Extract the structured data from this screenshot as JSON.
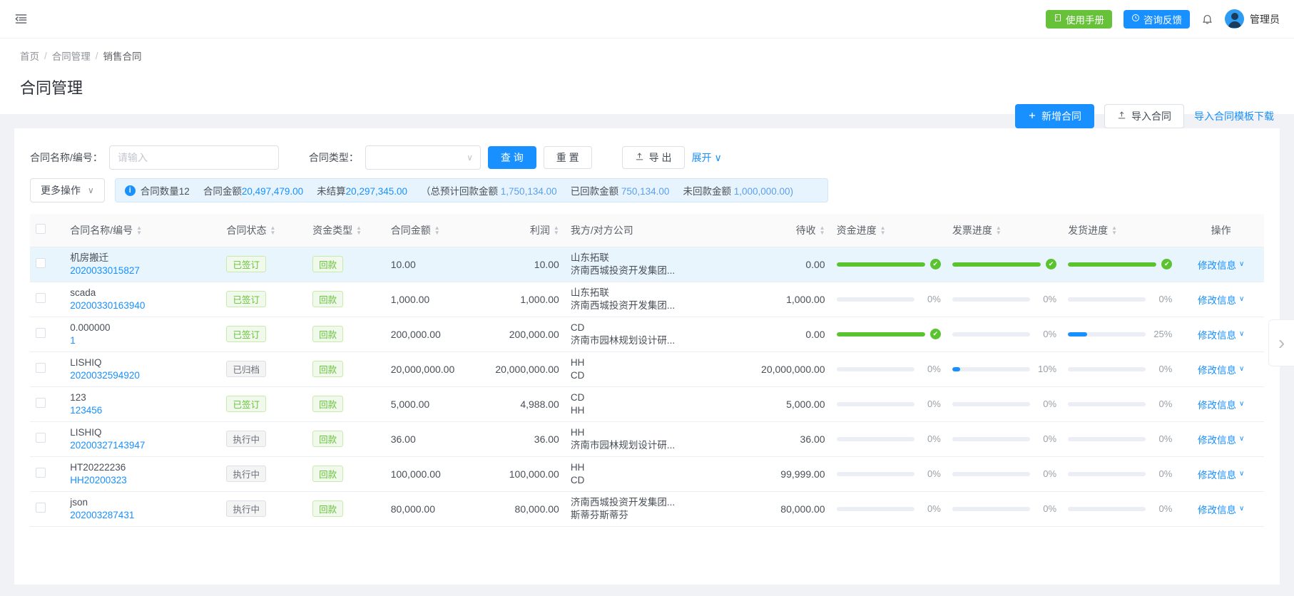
{
  "topbar": {
    "collapse_icon": "menu-fold-icon",
    "manual_button": "使用手册",
    "feedback_button": "咨询反馈",
    "bell_icon": "bell-icon",
    "user_name": "管理员"
  },
  "breadcrumb": {
    "items": [
      "首页",
      "合同管理",
      "销售合同"
    ],
    "separator": "/"
  },
  "page_title": "合同管理",
  "head_actions": {
    "add": "新增合同",
    "add_icon": "plus-icon",
    "import": "导入合同",
    "import_icon": "upload-icon",
    "template_link": "导入合同模板下载"
  },
  "filters": {
    "name_label": "合同名称/编号：",
    "name_value": "",
    "name_placeholder": "请输入",
    "type_label": "合同类型：",
    "type_value": "",
    "search": "查 询",
    "reset": "重 置",
    "export": "导 出",
    "export_icon": "upload-icon",
    "expand": "展开",
    "expand_caret": "∨"
  },
  "toolbar": {
    "more": "更多操作",
    "more_caret": "∨",
    "banner": {
      "info_icon": "info-icon",
      "count_label": "合同数量",
      "count_value": "12",
      "amount_label": "合同金额",
      "amount_value": "20,497,479.00",
      "unsettled_label": "未结算",
      "unsettled_value": "20,297,345.00",
      "paren_open": "（总预计回款金额",
      "expected_value": "1,750,134.00",
      "received_label": "已回款金额",
      "received_value": "750,134.00",
      "unreceived_label": "未回款金额",
      "unreceived_value": "1,000,000.00)"
    }
  },
  "table": {
    "columns": [
      {
        "label": "",
        "name": "select-all",
        "sortable": false
      },
      {
        "label": "合同名称/编号",
        "name": "name",
        "sortable": true
      },
      {
        "label": "合同状态",
        "name": "status",
        "sortable": true
      },
      {
        "label": "资金类型",
        "name": "fund-type",
        "sortable": true
      },
      {
        "label": "合同金额",
        "name": "amount",
        "sortable": true
      },
      {
        "label": "利润",
        "name": "profit",
        "sortable": true
      },
      {
        "label": "我方/对方公司",
        "name": "company",
        "sortable": false
      },
      {
        "label": "待收",
        "name": "receivable",
        "sortable": true
      },
      {
        "label": "资金进度",
        "name": "fund-progress",
        "sortable": true
      },
      {
        "label": "发票进度",
        "name": "invoice-progress",
        "sortable": true
      },
      {
        "label": "发货进度",
        "name": "delivery-progress",
        "sortable": true
      },
      {
        "label": "操作",
        "name": "operation",
        "sortable": false
      }
    ],
    "action_label": "修改信息",
    "action_caret": "∨",
    "rows": [
      {
        "highlighted": true,
        "name": "机房搬迁",
        "code": "2020033015827",
        "status": "已签订",
        "status_style": "green",
        "fund_type": "回款",
        "amount": "10.00",
        "profit": "10.00",
        "company_self": "山东拓联",
        "company_other": "济南西城投资开发集团...",
        "receivable": "0.00",
        "fund_pct": 100,
        "fund_text": "",
        "fund_done": true,
        "fund_color": "g",
        "invoice_pct": 100,
        "invoice_text": "",
        "invoice_done": true,
        "invoice_color": "g",
        "delivery_pct": 100,
        "delivery_text": "",
        "delivery_done": true,
        "delivery_color": "g"
      },
      {
        "highlighted": false,
        "name": "scada",
        "code": "20200330163940",
        "status": "已签订",
        "status_style": "green",
        "fund_type": "回款",
        "amount": "1,000.00",
        "profit": "1,000.00",
        "company_self": "山东拓联",
        "company_other": "济南西城投资开发集团...",
        "receivable": "1,000.00",
        "fund_pct": 0,
        "fund_text": "0%",
        "fund_done": false,
        "fund_color": "g",
        "invoice_pct": 0,
        "invoice_text": "0%",
        "invoice_done": false,
        "invoice_color": "g",
        "delivery_pct": 0,
        "delivery_text": "0%",
        "delivery_done": false,
        "delivery_color": "g"
      },
      {
        "highlighted": false,
        "name": "0.000000",
        "code": "1",
        "status": "已签订",
        "status_style": "green",
        "fund_type": "回款",
        "amount": "200,000.00",
        "profit": "200,000.00",
        "company_self": "CD",
        "company_other": "济南市园林规划设计研...",
        "receivable": "0.00",
        "fund_pct": 100,
        "fund_text": "",
        "fund_done": true,
        "fund_color": "g",
        "invoice_pct": 0,
        "invoice_text": "0%",
        "invoice_done": false,
        "invoice_color": "g",
        "delivery_pct": 25,
        "delivery_text": "25%",
        "delivery_done": false,
        "delivery_color": "b"
      },
      {
        "highlighted": false,
        "name": "LISHIQ",
        "code": "2020032594920",
        "status": "已归档",
        "status_style": "gray",
        "fund_type": "回款",
        "amount": "20,000,000.00",
        "profit": "20,000,000.00",
        "company_self": "HH",
        "company_other": "CD",
        "receivable": "20,000,000.00",
        "fund_pct": 0,
        "fund_text": "0%",
        "fund_done": false,
        "fund_color": "g",
        "invoice_pct": 10,
        "invoice_text": "10%",
        "invoice_done": false,
        "invoice_color": "b",
        "delivery_pct": 0,
        "delivery_text": "0%",
        "delivery_done": false,
        "delivery_color": "g"
      },
      {
        "highlighted": false,
        "name": "123",
        "code": "123456",
        "status": "已签订",
        "status_style": "green",
        "fund_type": "回款",
        "amount": "5,000.00",
        "profit": "4,988.00",
        "company_self": "CD",
        "company_other": "HH",
        "receivable": "5,000.00",
        "fund_pct": 0,
        "fund_text": "0%",
        "fund_done": false,
        "fund_color": "g",
        "invoice_pct": 0,
        "invoice_text": "0%",
        "invoice_done": false,
        "invoice_color": "g",
        "delivery_pct": 0,
        "delivery_text": "0%",
        "delivery_done": false,
        "delivery_color": "g"
      },
      {
        "highlighted": false,
        "name": "LISHIQ",
        "code": "20200327143947",
        "status": "执行中",
        "status_style": "gray",
        "fund_type": "回款",
        "amount": "36.00",
        "profit": "36.00",
        "company_self": "HH",
        "company_other": "济南市园林规划设计研...",
        "receivable": "36.00",
        "fund_pct": 0,
        "fund_text": "0%",
        "fund_done": false,
        "fund_color": "g",
        "invoice_pct": 0,
        "invoice_text": "0%",
        "invoice_done": false,
        "invoice_color": "g",
        "delivery_pct": 0,
        "delivery_text": "0%",
        "delivery_done": false,
        "delivery_color": "g"
      },
      {
        "highlighted": false,
        "name": "HT20222236",
        "code": "HH20200323",
        "status": "执行中",
        "status_style": "gray",
        "fund_type": "回款",
        "amount": "100,000.00",
        "profit": "100,000.00",
        "company_self": "HH",
        "company_other": "CD",
        "receivable": "99,999.00",
        "fund_pct": 0,
        "fund_text": "0%",
        "fund_done": false,
        "fund_color": "g",
        "invoice_pct": 0,
        "invoice_text": "0%",
        "invoice_done": false,
        "invoice_color": "g",
        "delivery_pct": 0,
        "delivery_text": "0%",
        "delivery_done": false,
        "delivery_color": "g"
      },
      {
        "highlighted": false,
        "name": "json",
        "code": "202003287431",
        "status": "执行中",
        "status_style": "gray",
        "fund_type": "回款",
        "amount": "80,000.00",
        "profit": "80,000.00",
        "company_self": "济南西城投资开发集团...",
        "company_other": "斯蒂芬斯蒂芬",
        "receivable": "80,000.00",
        "fund_pct": 0,
        "fund_text": "0%",
        "fund_done": false,
        "fund_color": "g",
        "invoice_pct": 0,
        "invoice_text": "0%",
        "invoice_done": false,
        "invoice_color": "g",
        "delivery_pct": 0,
        "delivery_text": "0%",
        "delivery_done": false,
        "delivery_color": "g"
      }
    ]
  },
  "pager_next_icon": "chevron-right-icon"
}
